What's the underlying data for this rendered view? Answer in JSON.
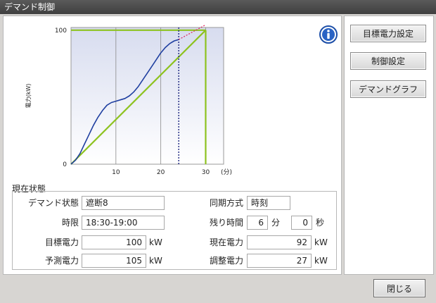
{
  "window": {
    "title": "デマンド制御"
  },
  "side_buttons": [
    "目標電力設定",
    "制御設定",
    "デマンドグラフ"
  ],
  "close_label": "閉じる",
  "status": {
    "section_label": "現在状態",
    "demand_state": {
      "label": "デマンド状態",
      "value": "遮断8"
    },
    "sync_method": {
      "label": "同期方式",
      "value": "時刻"
    },
    "period": {
      "label": "時限",
      "value": "18:30-19:00"
    },
    "remaining": {
      "label": "残り時間",
      "minutes": "6",
      "min_unit": "分",
      "seconds": "0",
      "sec_unit": "秒"
    },
    "target_power": {
      "label": "目標電力",
      "value": "100",
      "unit": "kW"
    },
    "current_power": {
      "label": "現在電力",
      "value": "92",
      "unit": "kW"
    },
    "predicted_power": {
      "label": "予測電力",
      "value": "105",
      "unit": "kW"
    },
    "adjust_power": {
      "label": "調整電力",
      "value": "27",
      "unit": "kW"
    }
  },
  "chart_data": {
    "type": "line",
    "ylabel": "電力(kW)",
    "xunit": "(分)",
    "xlim": [
      0,
      34
    ],
    "ylim": [
      0,
      102
    ],
    "x_ticks": [
      "10",
      "20",
      "30"
    ],
    "y_ticks": [
      "0",
      "100"
    ],
    "target_value": 100,
    "current_time": 24,
    "series": [
      {
        "values": [
          [
            0,
            0
          ],
          [
            1,
            3
          ],
          [
            2,
            8
          ],
          [
            3,
            15
          ],
          [
            4,
            22
          ],
          [
            5,
            29
          ],
          [
            6,
            35
          ],
          [
            7,
            40
          ],
          [
            8,
            44
          ],
          [
            9,
            46
          ],
          [
            10,
            47
          ],
          [
            11,
            48
          ],
          [
            12,
            49
          ],
          [
            13,
            51
          ],
          [
            14,
            54
          ],
          [
            15,
            58
          ],
          [
            16,
            63
          ],
          [
            17,
            68
          ],
          [
            18,
            73
          ],
          [
            19,
            78
          ],
          [
            20,
            83
          ],
          [
            21,
            87
          ],
          [
            22,
            90
          ],
          [
            23,
            92
          ],
          [
            24,
            93
          ]
        ]
      }
    ],
    "prediction_line": [
      [
        24,
        93
      ],
      [
        30,
        104
      ]
    ],
    "target_path": [
      [
        0,
        0
      ],
      [
        30,
        100
      ]
    ],
    "colors": {
      "demand": "#1f3fa0",
      "target": "#8dc21f",
      "prediction": "#e0205a",
      "current_time": "#1a237e"
    }
  }
}
